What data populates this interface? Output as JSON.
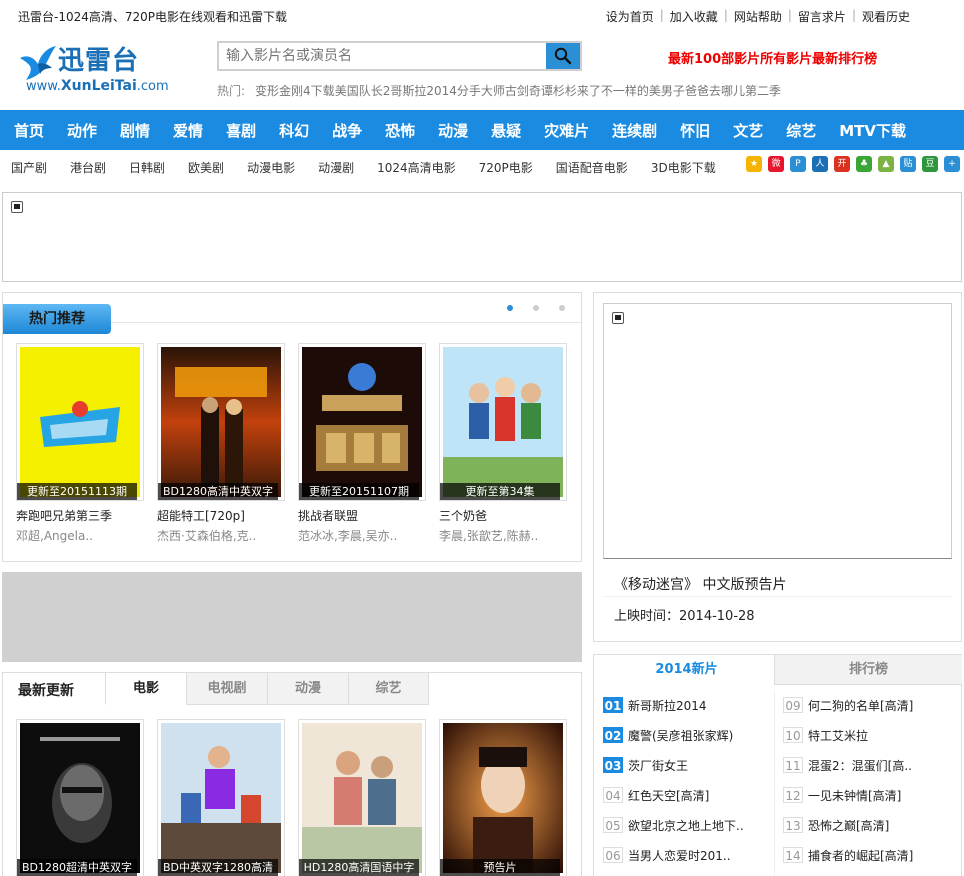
{
  "topbar": {
    "site_desc": "迅雷台-1024高清、720P电影在线观看和迅雷下载",
    "links": [
      "设为首页",
      "加入收藏",
      "网站帮助",
      "留言求片",
      "观看历史"
    ]
  },
  "logo": {
    "cn": "迅雷台",
    "en_prefix": "www.",
    "en_main": "XunLeiTai",
    "en_suffix": ".com"
  },
  "search": {
    "placeholder": "输入影片名或演员名",
    "hot_label": "热门:",
    "hot_terms": [
      "变形金刚4下载",
      "美国队长2",
      "哥斯拉2014",
      "分手大师",
      "古剑奇谭",
      "杉杉来了",
      "不一样的美男子",
      "爸爸去哪儿第二季"
    ]
  },
  "header_links": [
    "最新100部影片",
    "所有影片",
    "最新排行榜"
  ],
  "nav": [
    "首页",
    "动作",
    "剧情",
    "爱情",
    "喜剧",
    "科幻",
    "战争",
    "恐怖",
    "动漫",
    "悬疑",
    "灾难片",
    "连续剧",
    "怀旧",
    "文艺",
    "综艺",
    "MTV下载"
  ],
  "subnav": [
    "国产剧",
    "港台剧",
    "日韩剧",
    "欧美剧",
    "动漫电影",
    "动漫剧",
    "1024高清电影",
    "720P电影",
    "国语配音电影",
    "3D电影下载"
  ],
  "colors": {
    "brand": "#1a8be0",
    "red": "#ee0000",
    "band": "#d0d0d0"
  },
  "hot_section": {
    "title": "热门推荐",
    "items": [
      {
        "caption": "更新至20151113期",
        "title": "奔跑吧兄弟第三季",
        "actors": "邓超,Angela.."
      },
      {
        "caption": "BD1280高清中英双字",
        "title": "超能特工[720p]",
        "actors": "杰西·艾森伯格,克.."
      },
      {
        "caption": "更新至20151107期",
        "title": "挑战者联盟",
        "actors": "范冰冰,李晨,吴亦.."
      },
      {
        "caption": "更新至第34集",
        "title": "三个奶爸",
        "actors": "李晨,张歆艺,陈赫.."
      }
    ]
  },
  "latest": {
    "title": "最新更新",
    "tabs": [
      "电影",
      "电视剧",
      "动漫",
      "综艺"
    ],
    "items": [
      {
        "caption": "BD1280超清中英双字"
      },
      {
        "caption": "BD中英双字1280高清"
      },
      {
        "caption": "HD1280高清国语中字"
      },
      {
        "caption": "预告片"
      }
    ]
  },
  "video": {
    "title": "《移动迷宫》 中文版预告片",
    "date": "上映时间：2014-10-28"
  },
  "rank": {
    "tabs": [
      "2014新片",
      "排行榜"
    ],
    "left": [
      {
        "n": "01",
        "t": "新哥斯拉2014"
      },
      {
        "n": "02",
        "t": "魔警(吴彦祖张家辉)"
      },
      {
        "n": "03",
        "t": "茨厂街女王"
      },
      {
        "n": "04",
        "t": "红色天空[高清]"
      },
      {
        "n": "05",
        "t": "欲望北京之地上地下.."
      },
      {
        "n": "06",
        "t": "当男人恋爱时201.."
      }
    ],
    "right": [
      {
        "n": "09",
        "t": "何二狗的名单[高清]"
      },
      {
        "n": "10",
        "t": "特工艾米拉"
      },
      {
        "n": "11",
        "t": "混蛋2：混蛋们[高.."
      },
      {
        "n": "12",
        "t": "一见未钟情[高清]"
      },
      {
        "n": "13",
        "t": "恐怖之巅[高清]"
      },
      {
        "n": "14",
        "t": "捕食者的崛起[高清]"
      }
    ]
  }
}
